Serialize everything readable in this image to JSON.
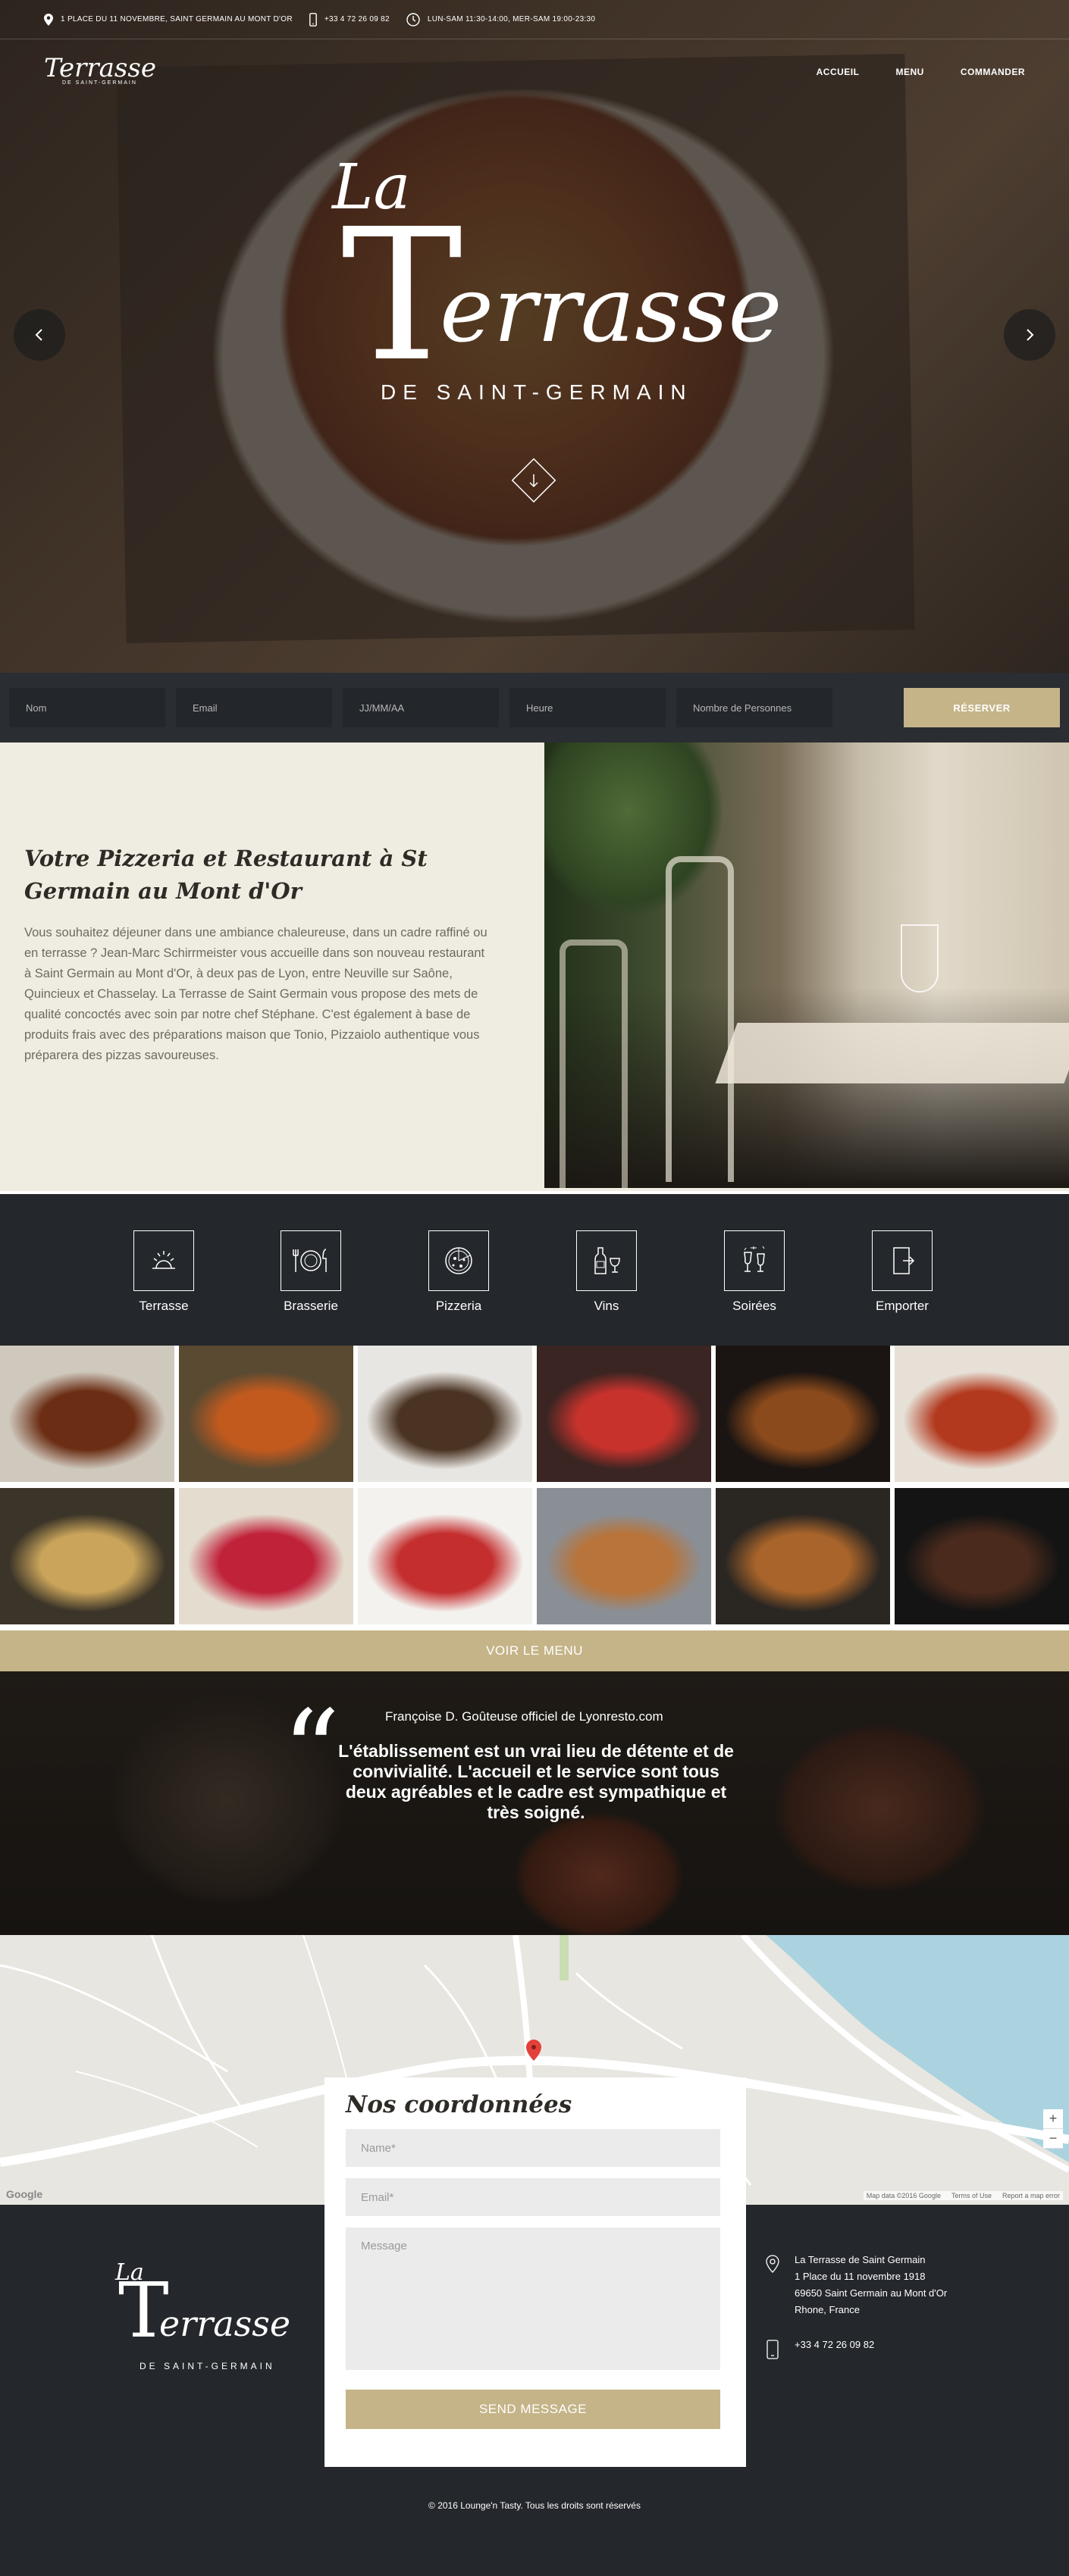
{
  "topbar": {
    "address": "1 PLACE DU 11 NOVEMBRE, SAINT GERMAIN AU MONT D'OR",
    "phone": "+33 4 72 26 09 82",
    "hours": "LUN-SAM 11:30-14:00, MER-SAM 19:00-23:30"
  },
  "logo": {
    "la": "La",
    "terrasse": "Terrasse",
    "t": "T",
    "rest": "errasse",
    "subtitle": "DE SAINT-GERMAIN"
  },
  "nav": [
    "ACCUEIL",
    "MENU",
    "COMMANDER"
  ],
  "booking": {
    "fields": [
      "Nom",
      "Email",
      "JJ/MM/AA",
      "Heure",
      "Nombre de Personnes"
    ],
    "button": "RÉSERVER"
  },
  "about": {
    "title": "Votre Pizzeria et Restaurant à St Germain au Mont d'Or",
    "body": "Vous souhaitez déjeuner dans une ambiance chaleureuse, dans un cadre raffiné ou en terrasse ? Jean-Marc Schirrmeister vous accueille dans son nouveau restaurant à Saint Germain au Mont d'Or, à deux pas de Lyon, entre Neuville sur Saône, Quincieux et Chasselay. La Terrasse de Saint Germain vous propose des mets de qualité concoctés avec soin par notre chef Stéphane. C'est également à base de produits frais avec des préparations maison que Tonio, Pizzaiolo authentique vous préparera des pizzas savoureuses."
  },
  "features": [
    {
      "icon": "sun-icon",
      "label": "Terrasse"
    },
    {
      "icon": "plate-icon",
      "label": "Brasserie"
    },
    {
      "icon": "pizza-icon",
      "label": "Pizzeria"
    },
    {
      "icon": "wine-icon",
      "label": "Vins"
    },
    {
      "icon": "champagne-icon",
      "label": "Soirées"
    },
    {
      "icon": "takeaway-icon",
      "label": "Emporter"
    }
  ],
  "gallery_colors": [
    [
      "#cfc8bd",
      "#6b2e14"
    ],
    [
      "#5a4a32",
      "#c25a1e"
    ],
    [
      "#e8e6e2",
      "#4a3322"
    ],
    [
      "#3a2522",
      "#c8322c"
    ],
    [
      "#1a1412",
      "#8a4a1c"
    ],
    [
      "#e6e0d6",
      "#b2391e"
    ],
    [
      "#3b3428",
      "#c9a45a"
    ],
    [
      "#e4ddcf",
      "#c0223a"
    ],
    [
      "#f3f2ef",
      "#c42e2e"
    ],
    [
      "#8a8f96",
      "#b8743a"
    ],
    [
      "#2a2622",
      "#a8642a"
    ],
    [
      "#141414",
      "#4a2a1c"
    ]
  ],
  "menu_button": "VOIR LE MENU",
  "testimonial": {
    "author": "Françoise D. Goûteuse officiel de Lyonresto.com",
    "quote": "L'établissement est un vrai lieu de détente et de convivialité. L'accueil et le service sont tous deux agréables et le cadre est sympathique et très soigné.",
    "mark": "“"
  },
  "map": {
    "google": "Google",
    "attribution": [
      "Map data ©2016 Google",
      "Terms of Use",
      "Report a map error"
    ],
    "zoom_in": "+",
    "zoom_out": "−"
  },
  "contact_form": {
    "title": "Nos coordonnées",
    "name_placeholder": "Name*",
    "email_placeholder": "Email*",
    "message_placeholder": "Message",
    "send": "SEND MESSAGE"
  },
  "footer": {
    "address_lines": [
      "La Terrasse de Saint Germain",
      "1 Place du 11 novembre 1918",
      "69650 Saint Germain au Mont d'Or",
      "Rhone, France"
    ],
    "phone": "+33 4 72 26 09 82",
    "copyright": "© 2016 Lounge'n Tasty. Tous les droits sont réservés"
  },
  "colors": {
    "accent": "#c5b488",
    "dark": "#24272b",
    "cream": "#efece1"
  }
}
